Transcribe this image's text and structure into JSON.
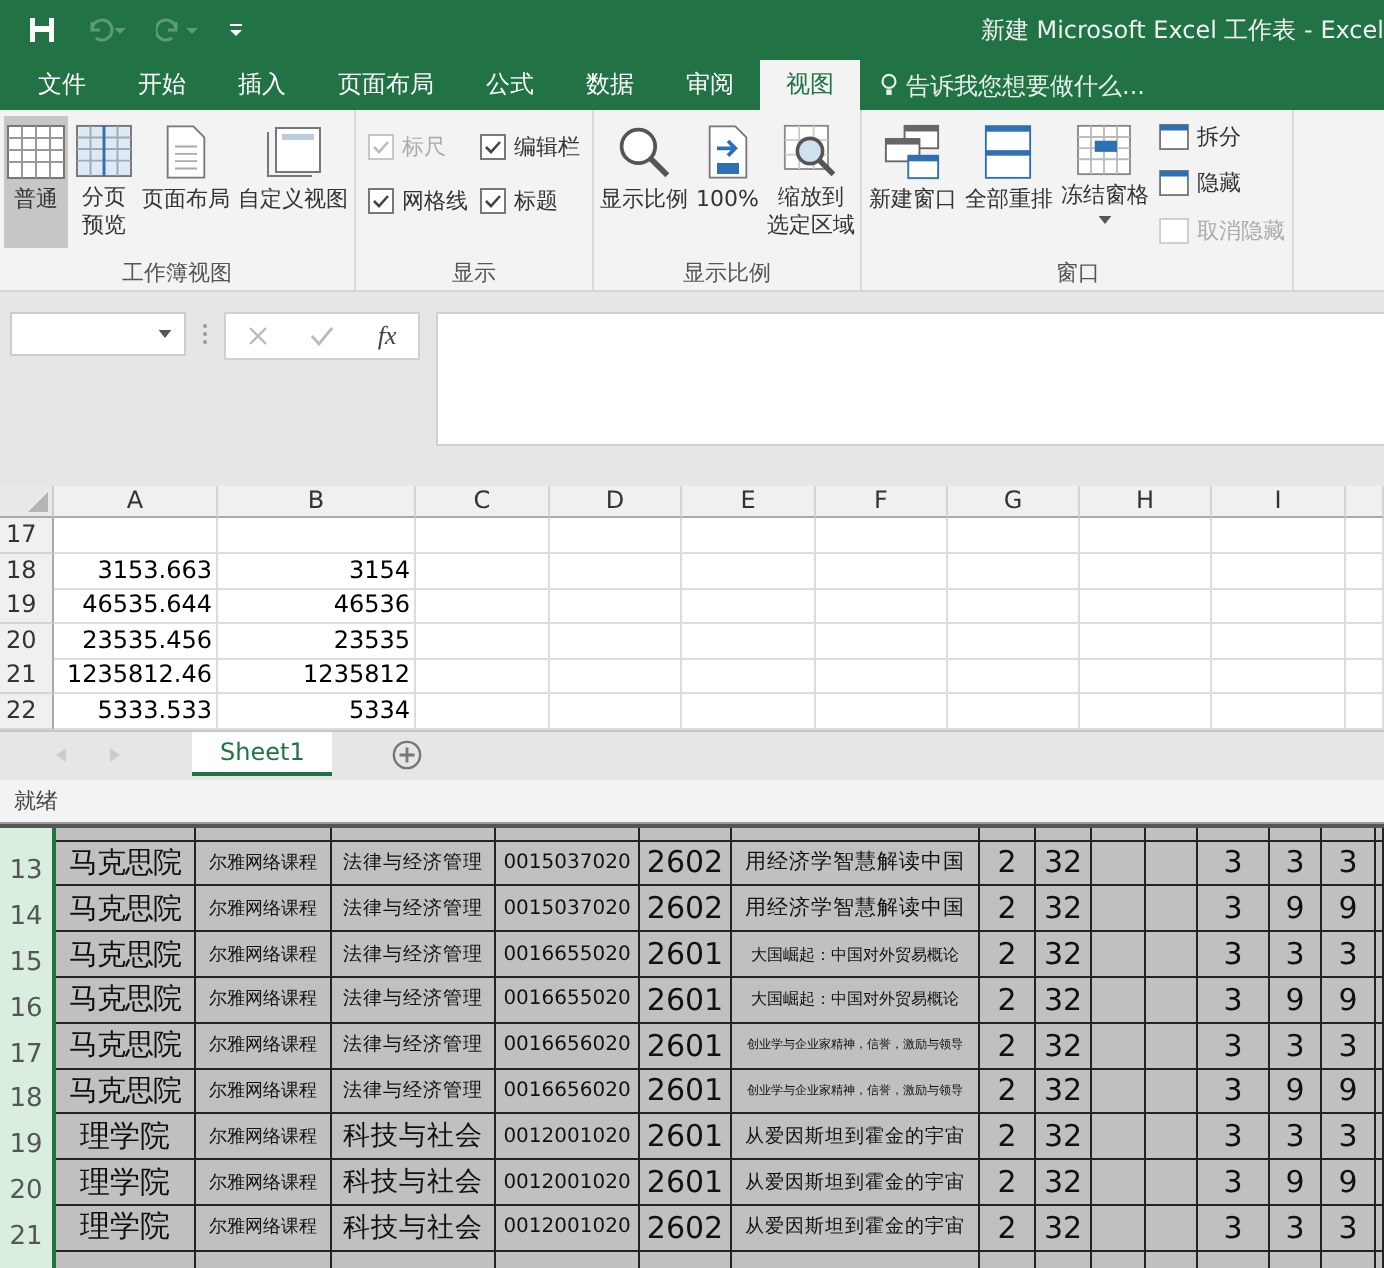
{
  "window": {
    "title": "新建 Microsoft Excel 工作表 - Excel"
  },
  "tabs": [
    {
      "label": "文件",
      "selected": false
    },
    {
      "label": "开始",
      "selected": false
    },
    {
      "label": "插入",
      "selected": false
    },
    {
      "label": "页面布局",
      "selected": false
    },
    {
      "label": "公式",
      "selected": false
    },
    {
      "label": "数据",
      "selected": false
    },
    {
      "label": "审阅",
      "selected": false
    },
    {
      "label": "视图",
      "selected": true
    }
  ],
  "tell_me": {
    "placeholder": "告诉我您想要做什么..."
  },
  "ribbon_groups": [
    {
      "label": "工作簿视图",
      "items": [
        {
          "kind": "big",
          "lines": [
            "普通"
          ],
          "selected": true
        },
        {
          "kind": "big",
          "lines": [
            "分页",
            "预览"
          ],
          "selected": false
        },
        {
          "kind": "big",
          "lines": [
            "页面布局"
          ],
          "selected": false
        },
        {
          "kind": "big",
          "lines": [
            "自定义视图"
          ],
          "selected": false
        }
      ]
    },
    {
      "label": "显示",
      "items": [
        {
          "kind": "check",
          "lines": [
            "标尺"
          ],
          "checked": true,
          "disabled": true
        },
        {
          "kind": "check",
          "lines": [
            "编辑栏"
          ],
          "checked": true,
          "disabled": false
        },
        {
          "kind": "check",
          "lines": [
            "网格线"
          ],
          "checked": true,
          "disabled": false
        },
        {
          "kind": "check",
          "lines": [
            "标题"
          ],
          "checked": true,
          "disabled": false
        }
      ]
    },
    {
      "label": "显示比例",
      "items": [
        {
          "kind": "big",
          "lines": [
            "显示比例"
          ]
        },
        {
          "kind": "big",
          "lines": [
            "100%"
          ]
        },
        {
          "kind": "big",
          "lines": [
            "缩放到",
            "选定区域"
          ]
        }
      ]
    },
    {
      "label": "窗口",
      "items": [
        {
          "kind": "big",
          "lines": [
            "新建窗口"
          ]
        },
        {
          "kind": "big",
          "lines": [
            "全部重排"
          ]
        },
        {
          "kind": "big",
          "lines": [
            "冻结窗格"
          ],
          "dropdown": true
        },
        {
          "kind": "small",
          "lines": [
            "拆分"
          ],
          "disabled": false
        },
        {
          "kind": "small",
          "lines": [
            "隐藏"
          ],
          "disabled": false
        },
        {
          "kind": "small",
          "lines": [
            "取消隐藏"
          ],
          "disabled": true
        }
      ]
    }
  ],
  "formula_bar": {
    "function_label": "fx"
  },
  "sheet": {
    "columns": [
      "A",
      "B",
      "C",
      "D",
      "E",
      "F",
      "G",
      "H",
      "I"
    ],
    "rows": [
      {
        "number": "17",
        "cells": []
      },
      {
        "number": "18",
        "cells": [
          "3153.663",
          "3154"
        ]
      },
      {
        "number": "19",
        "cells": [
          "46535.644",
          "46536"
        ]
      },
      {
        "number": "20",
        "cells": [
          "23535.456",
          "23535"
        ]
      },
      {
        "number": "21",
        "cells": [
          "1235812.46",
          "1235812"
        ]
      },
      {
        "number": "22",
        "cells": [
          "5333.533",
          "5334"
        ]
      }
    ]
  },
  "sheet_tabs": [
    {
      "label": "Sheet1",
      "selected": true
    }
  ],
  "status_bar": {
    "text": "就绪"
  },
  "pasted_table": {
    "rows": [
      {
        "number": "13",
        "cells": [
          "马克思院",
          "尔雅网络课程",
          "法律与经济管理",
          "0015037020",
          "2602",
          "用经济学智慧解读中国",
          "2",
          "32",
          null,
          null,
          "3",
          "3",
          "3"
        ]
      },
      {
        "number": "14",
        "cells": [
          "马克思院",
          "尔雅网络课程",
          "法律与经济管理",
          "0015037020",
          "2602",
          "用经济学智慧解读中国",
          "2",
          "32",
          null,
          null,
          "3",
          "9",
          "9"
        ]
      },
      {
        "number": "15",
        "cells": [
          "马克思院",
          "尔雅网络课程",
          "法律与经济管理",
          "0016655020",
          "2601",
          "大国崛起：中国对外贸易概论",
          "2",
          "32",
          null,
          null,
          "3",
          "3",
          "3"
        ]
      },
      {
        "number": "16",
        "cells": [
          "马克思院",
          "尔雅网络课程",
          "法律与经济管理",
          "0016655020",
          "2601",
          "大国崛起：中国对外贸易概论",
          "2",
          "32",
          null,
          null,
          "3",
          "9",
          "9"
        ]
      },
      {
        "number": "17",
        "cells": [
          "马克思院",
          "尔雅网络课程",
          "法律与经济管理",
          "0016656020",
          "2601",
          "创业学与企业家精神，信誉，激励与领导",
          "2",
          "32",
          null,
          null,
          "3",
          "3",
          "3"
        ]
      },
      {
        "number": "18",
        "cells": [
          "马克思院",
          "尔雅网络课程",
          "法律与经济管理",
          "0016656020",
          "2601",
          "创业学与企业家精神，信誉，激励与领导",
          "2",
          "32",
          null,
          null,
          "3",
          "9",
          "9"
        ]
      },
      {
        "number": "19",
        "cells": [
          "理学院",
          "尔雅网络课程",
          "科技与社会",
          "0012001020",
          "2601",
          "从爱因斯坦到霍金的宇宙",
          "2",
          "32",
          null,
          null,
          "3",
          "3",
          "3"
        ]
      },
      {
        "number": "20",
        "cells": [
          "理学院",
          "尔雅网络课程",
          "科技与社会",
          "0012001020",
          "2601",
          "从爱因斯坦到霍金的宇宙",
          "2",
          "32",
          null,
          null,
          "3",
          "9",
          "9"
        ]
      },
      {
        "number": "21",
        "cells": [
          "理学院",
          "尔雅网络课程",
          "科技与社会",
          "0012001020",
          "2602",
          "从爱因斯坦到霍金的宇宙",
          "2",
          "32",
          null,
          null,
          "3",
          "3",
          "3"
        ]
      }
    ]
  }
}
